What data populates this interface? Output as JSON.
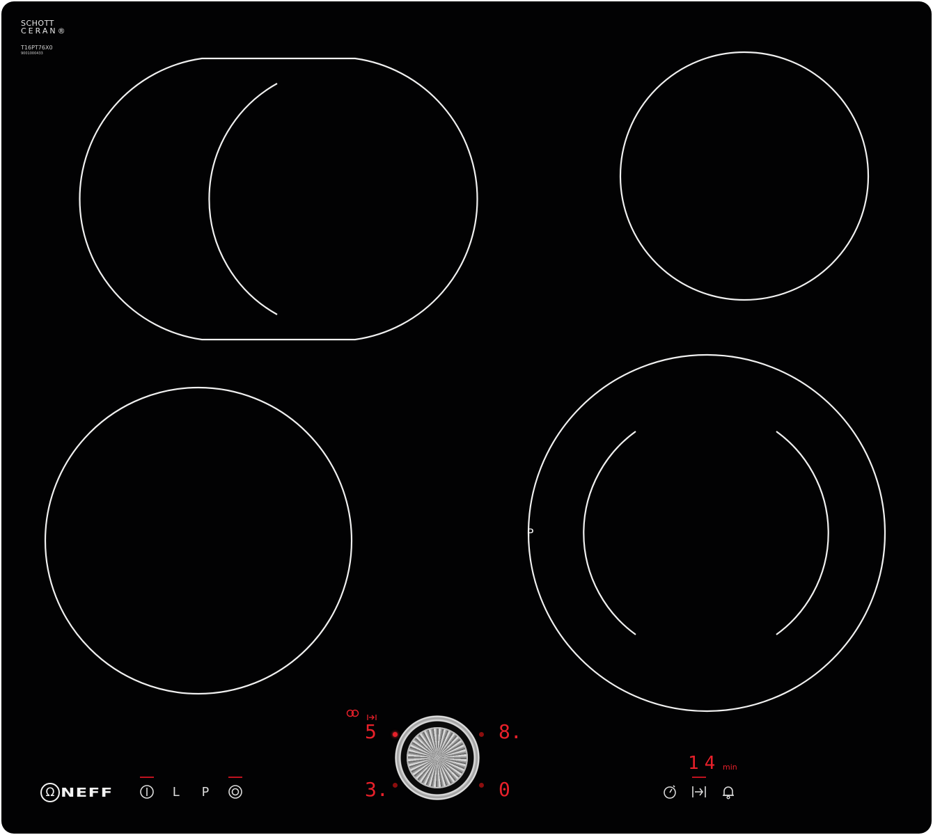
{
  "appliance": {
    "glass_brand_line1": "SCHOTT",
    "glass_brand_line2": "CERAN®",
    "model_number": "T16PT76X0",
    "serial_number": "9001000433",
    "maker_logo": "NEFF",
    "maker_logo_icon": "omega-icon"
  },
  "cooking_zones": [
    {
      "name": "front-left-zone",
      "type": "extended-oval-with-inner-arc"
    },
    {
      "name": "rear-right-zone",
      "type": "single-circle"
    },
    {
      "name": "rear-left-zone",
      "type": "single-circle"
    },
    {
      "name": "front-right-zone",
      "type": "dual-circle"
    }
  ],
  "zone_label": "P",
  "left_controls": {
    "power_icon": "power-icon",
    "lock_label": "L",
    "power_boost_label": "P",
    "zone_select_icon": "dual-zone-icon"
  },
  "center_controls": {
    "link_icon": "infinity-link-icon",
    "timer_small_icon": "timer-arrow-icon",
    "display_top_left": "5",
    "display_top_right": "8.",
    "display_bottom_left": "3.",
    "display_bottom_right": "0",
    "knob": "twist-pad-knob"
  },
  "timer": {
    "value": "14",
    "unit": "min",
    "clock_icon": "stopwatch-icon",
    "cooking_timer_icon": "timer-arrow-icon",
    "alarm_icon": "bell-icon"
  },
  "colors": {
    "glass": "#020203",
    "zone_lines": "#f0f0f0",
    "display_red": "#e8202a"
  }
}
